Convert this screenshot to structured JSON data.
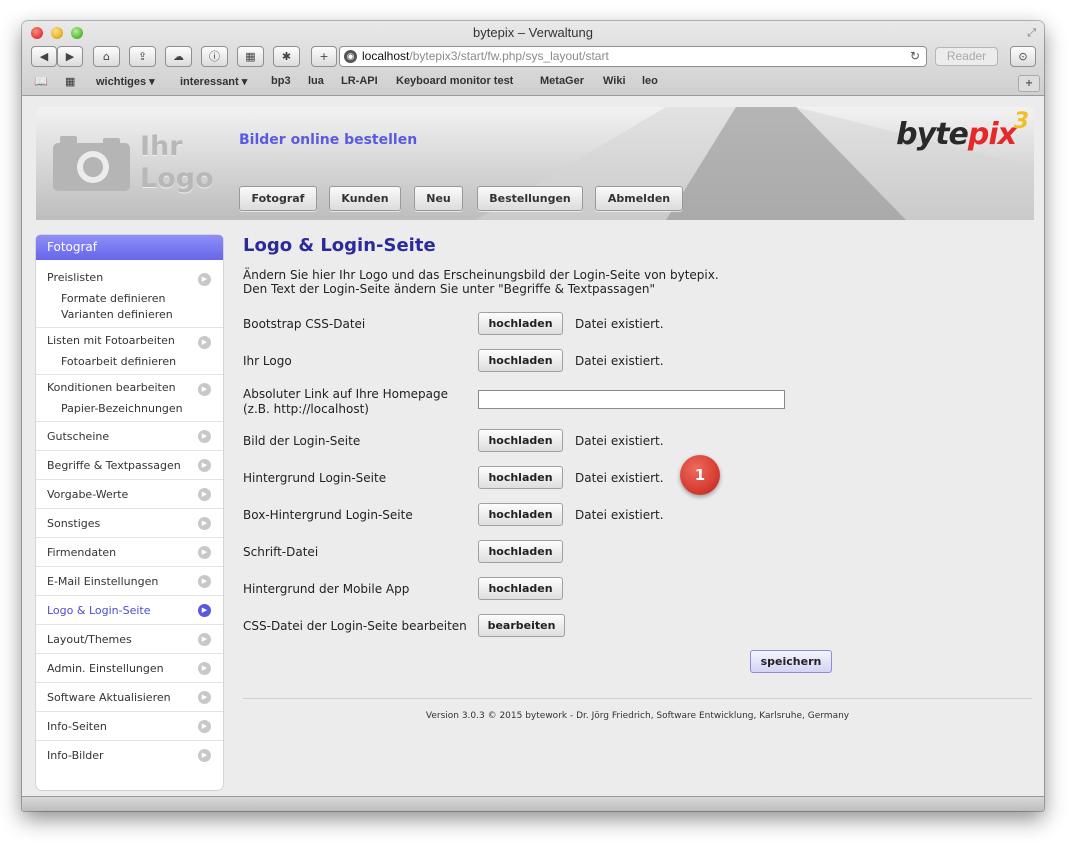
{
  "window": {
    "title": "bytepix – Verwaltung"
  },
  "url": {
    "host": "localhost",
    "path": "/bytepix3/start/fw.php/sys_layout/start"
  },
  "toolbar": {
    "reader": "Reader"
  },
  "bookmarks": [
    "wichtiges ▾",
    "interessant ▾",
    "bp3",
    "lua",
    "LR-API",
    "Keyboard monitor test",
    "MetaGer",
    "Wiki",
    "leo"
  ],
  "header": {
    "logo_line1": "Ihr",
    "logo_line2": "Logo",
    "tagline": "Bilder online bestellen",
    "brand_a": "byte",
    "brand_b": "pix",
    "brand_c": "3",
    "menu": [
      "Fotograf",
      "Kunden",
      "Neu",
      "Bestellungen",
      "Abmelden"
    ]
  },
  "sidebar": {
    "heading": "Fotograf",
    "items": [
      {
        "label": "Preislisten"
      },
      {
        "label": "Formate definieren"
      },
      {
        "label": "Varianten definieren"
      },
      {
        "label": "Listen mit Fotoarbeiten"
      },
      {
        "label": "Fotoarbeit definieren"
      },
      {
        "label": "Konditionen bearbeiten"
      },
      {
        "label": "Papier-Bezeichnungen"
      },
      {
        "label": "Gutscheine"
      },
      {
        "label": "Begriffe & Textpassagen"
      },
      {
        "label": "Vorgabe-Werte"
      },
      {
        "label": "Sonstiges"
      },
      {
        "label": "Firmendaten"
      },
      {
        "label": "E-Mail Einstellungen"
      },
      {
        "label": "Logo & Login-Seite"
      },
      {
        "label": "Layout/Themes"
      },
      {
        "label": "Admin. Einstellungen"
      },
      {
        "label": "Software Aktualisieren"
      },
      {
        "label": "Info-Seiten"
      },
      {
        "label": "Info-Bilder"
      }
    ]
  },
  "main": {
    "title": "Logo & Login-Seite",
    "intro_line1": "Ändern Sie hier Ihr Logo und das Erscheinungsbild der Login-Seite von bytepix.",
    "intro_line2": "Den Text der Login-Seite ändern Sie unter \"Begriffe & Textpassagen\"",
    "upload_label": "hochladen",
    "edit_label": "bearbeiten",
    "status_exists": "Datei existiert.",
    "rows": [
      {
        "label": "Bootstrap CSS-Datei"
      },
      {
        "label": "Ihr Logo"
      },
      {
        "label_line1": "Absoluter Link auf Ihre Homepage",
        "label_line2": "(z.B. http://localhost)",
        "value": ""
      },
      {
        "label": "Bild der Login-Seite"
      },
      {
        "label": "Hintergrund Login-Seite"
      },
      {
        "label": "Box-Hintergrund Login-Seite"
      },
      {
        "label": "Schrift-Datei"
      },
      {
        "label": "Hintergrund der Mobile App"
      },
      {
        "label": "CSS-Datei der Login-Seite bearbeiten"
      }
    ],
    "badge": "1",
    "save_label": "speichern",
    "footer": "Version 3.0.3 © 2015 bytework - Dr. Jörg Friedrich, Software Entwicklung, Karlsruhe, Germany"
  },
  "colors": {
    "accent": "#6666ea",
    "title": "#2a2a9a",
    "badge": "#d43a2f",
    "brand_red": "#e5282a"
  }
}
